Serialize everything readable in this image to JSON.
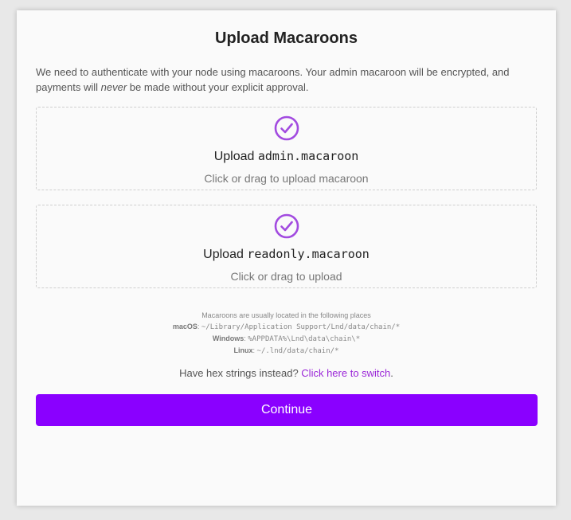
{
  "title": "Upload Macaroons",
  "intro": {
    "before": "We need to authenticate with your node using macaroons. Your admin macaroon will be encrypted, and payments will ",
    "emphasis": "never",
    "after": " be made without your explicit approval."
  },
  "admin_dropzone": {
    "prefix": "Upload ",
    "filename": "admin.macaroon",
    "hint": "Click or drag to upload macaroon",
    "icon": "check-circle-icon"
  },
  "readonly_dropzone": {
    "prefix": "Upload ",
    "filename": "readonly.macaroon",
    "hint": "Click or drag to upload",
    "icon": "check-circle-icon"
  },
  "locations": {
    "heading": "Macaroons are usually located in the following places",
    "items": [
      {
        "os": "macOS",
        "path": "~/Library/Application Support/Lnd/data/chain/*"
      },
      {
        "os": "Windows",
        "path": "%APPDATA%\\Lnd\\data\\chain\\*"
      },
      {
        "os": "Linux",
        "path": "~/.lnd/data/chain/*"
      }
    ]
  },
  "switch": {
    "text": "Have hex strings instead? ",
    "link": "Click here to switch",
    "suffix": "."
  },
  "continue_label": "Continue",
  "colors": {
    "accent": "#8a00ff",
    "check": "#a24be0",
    "link": "#9b27d8"
  }
}
